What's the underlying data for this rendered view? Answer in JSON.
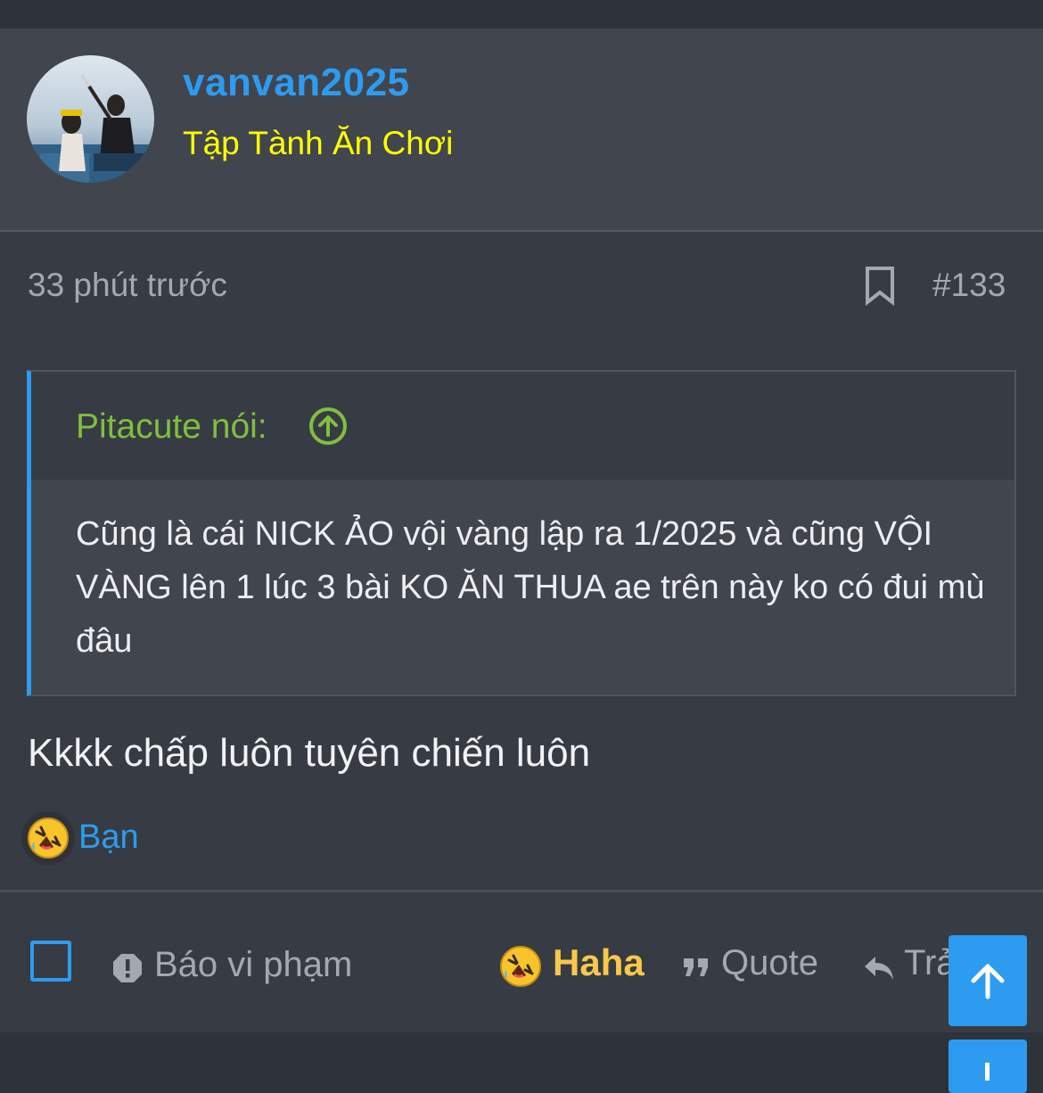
{
  "post": {
    "author": {
      "username": "vanvan2025",
      "title": "Tập Tành Ăn Chơi"
    },
    "time": "33 phút trước",
    "number": "#133",
    "quote": {
      "author": "Pitacute nói:",
      "text": "Cũng là cái NICK ẢO vội vàng lập ra 1/2025 và cũng VỘI VÀNG lên 1 lúc 3 bài KO ĂN THUA ae trên này ko có đui mù đâu"
    },
    "message": "Kkkk chấp luôn tuyên chiến luôn",
    "reactions": {
      "icon": "rolling-laughing-emoji",
      "names": "Bạn"
    },
    "actions": {
      "report": "Báo vi phạm",
      "haha": "Haha",
      "quote": "Quote",
      "reply": "Trả lời"
    }
  },
  "colors": {
    "background": "#2e3239",
    "post_background": "#373b43",
    "header_background": "#41454d",
    "accent": "#2d9cf0",
    "user_title": "#ffff00",
    "quote_author": "#7fbf3f",
    "haha": "#f9c84a",
    "muted_text": "#a4a9b1"
  }
}
